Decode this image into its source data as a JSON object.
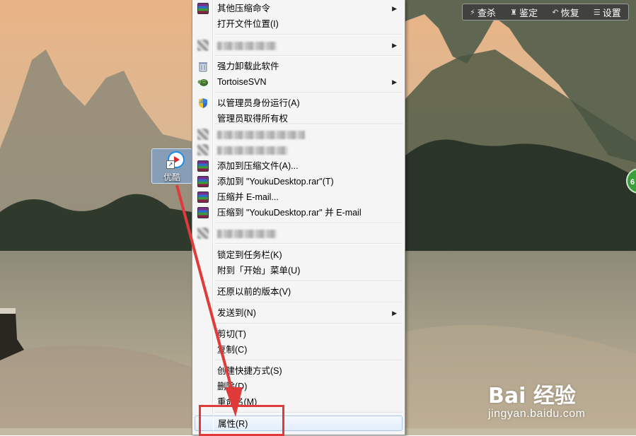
{
  "toolbar": {
    "items": [
      {
        "label": "查杀",
        "icon": "lightning-icon"
      },
      {
        "label": "鉴定",
        "icon": "stamp-icon"
      },
      {
        "label": "恢复",
        "icon": "undo-icon"
      },
      {
        "label": "设置",
        "icon": "list-icon"
      }
    ]
  },
  "desktop_icon": {
    "label": "优酷",
    "icon": "youku-logo-icon"
  },
  "menu": {
    "items": [
      {
        "label": "其他压缩命令",
        "has_submenu": true
      },
      {
        "label": "打开文件位置(I)"
      },
      {
        "label": "",
        "blurred": true,
        "has_submenu": true
      },
      {
        "label": "强力卸载此软件"
      },
      {
        "label": "TortoiseSVN",
        "has_submenu": true
      },
      {
        "label": "以管理员身份运行(A)"
      },
      {
        "label": "管理员取得所有权"
      },
      {
        "label": "",
        "blurred": true
      },
      {
        "label": "",
        "blurred": true
      },
      {
        "label": "添加到压缩文件(A)..."
      },
      {
        "label": "添加到 \"YoukuDesktop.rar\"(T)"
      },
      {
        "label": "压缩并 E-mail..."
      },
      {
        "label": "压缩到 \"YoukuDesktop.rar\" 并 E-mail"
      },
      {
        "label": "",
        "blurred": true
      },
      {
        "label": "锁定到任务栏(K)"
      },
      {
        "label": "附到「开始」菜单(U)"
      },
      {
        "label": "还原以前的版本(V)"
      },
      {
        "label": "发送到(N)",
        "has_submenu": true
      },
      {
        "label": "剪切(T)"
      },
      {
        "label": "复制(C)"
      },
      {
        "label": "创建快捷方式(S)"
      },
      {
        "label": "删除(D)"
      },
      {
        "label": "重命名(M)"
      },
      {
        "label": "属性(R)",
        "highlighted": true
      }
    ]
  },
  "right_badge": {
    "label": "6"
  },
  "watermark": {
    "brand": "Bai 经验",
    "site": "jingyan.baidu.com"
  },
  "colors": {
    "annotation_red": "#e03a3a",
    "menu_bg": "#f5f5f5",
    "highlight_border": "#a9c6ea"
  }
}
